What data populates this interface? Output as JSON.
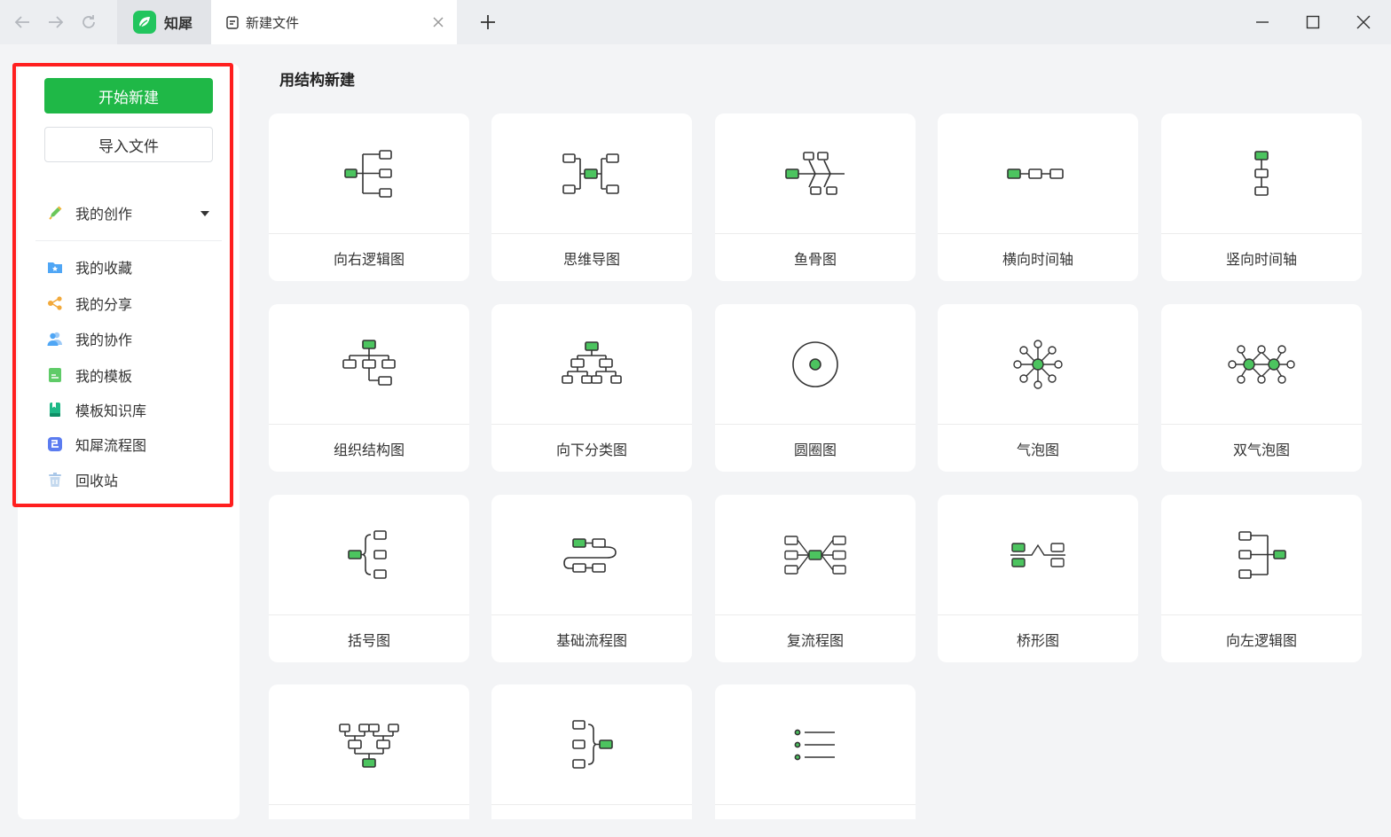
{
  "app": {
    "name": "知犀"
  },
  "tab": {
    "title": "新建文件"
  },
  "sidebar": {
    "new_button": "开始新建",
    "import_button": "导入文件",
    "items": [
      {
        "label": "我的创作",
        "icon": "pencil-icon"
      },
      {
        "label": "我的收藏",
        "icon": "star-folder-icon"
      },
      {
        "label": "我的分享",
        "icon": "share-icon"
      },
      {
        "label": "我的协作",
        "icon": "users-icon"
      },
      {
        "label": "我的模板",
        "icon": "template-icon"
      },
      {
        "label": "模板知识库",
        "icon": "book-icon"
      },
      {
        "label": "知犀流程图",
        "icon": "flowchart-app-icon"
      },
      {
        "label": "回收站",
        "icon": "trash-icon"
      }
    ]
  },
  "main": {
    "section_title": "用结构新建",
    "templates": [
      {
        "label": "向右逻辑图"
      },
      {
        "label": "思维导图"
      },
      {
        "label": "鱼骨图"
      },
      {
        "label": "横向时间轴"
      },
      {
        "label": "竖向时间轴"
      },
      {
        "label": "组织结构图"
      },
      {
        "label": "向下分类图"
      },
      {
        "label": "圆圈图"
      },
      {
        "label": "气泡图"
      },
      {
        "label": "双气泡图"
      },
      {
        "label": "括号图"
      },
      {
        "label": "基础流程图"
      },
      {
        "label": "复流程图"
      },
      {
        "label": "桥形图"
      },
      {
        "label": "向左逻辑图"
      },
      {
        "label": ""
      },
      {
        "label": ""
      },
      {
        "label": ""
      }
    ]
  },
  "colors": {
    "accent": "#1fb847",
    "node_fill": "#4cc45f",
    "highlight": "#ff1f1f"
  }
}
